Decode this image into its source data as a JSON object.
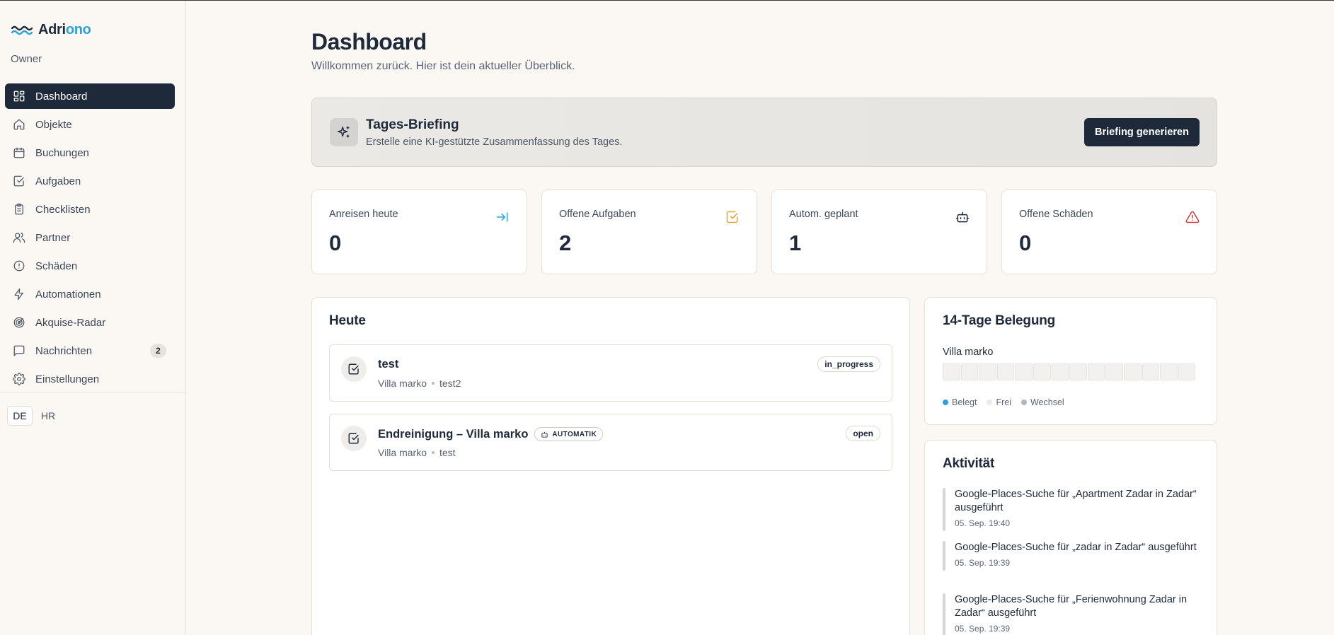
{
  "brand": {
    "part1": "Adri",
    "part2": "ono"
  },
  "role": "Owner",
  "nav": [
    {
      "label": "Dashboard",
      "icon": "dashboard-icon"
    },
    {
      "label": "Objekte",
      "icon": "home-icon"
    },
    {
      "label": "Buchungen",
      "icon": "calendar-icon"
    },
    {
      "label": "Aufgaben",
      "icon": "check-square-icon"
    },
    {
      "label": "Checklisten",
      "icon": "clipboard-icon"
    },
    {
      "label": "Partner",
      "icon": "users-icon"
    },
    {
      "label": "Schäden",
      "icon": "alert-circle-icon"
    },
    {
      "label": "Automationen",
      "icon": "zap-icon"
    },
    {
      "label": "Akquise-Radar",
      "icon": "radar-icon"
    },
    {
      "label": "Nachrichten",
      "icon": "message-icon",
      "badge": "2"
    },
    {
      "label": "Einstellungen",
      "icon": "gear-icon"
    }
  ],
  "languages": {
    "de": "DE",
    "hr": "HR",
    "active": "DE"
  },
  "header": {
    "title": "Dashboard",
    "subtitle": "Willkommen zurück. Hier ist dein aktueller Überblick."
  },
  "briefing": {
    "title": "Tages-Briefing",
    "subtitle": "Erstelle eine KI-gestützte Zusammenfassung des Tages.",
    "button": "Briefing generieren"
  },
  "stats": [
    {
      "label": "Anreisen heute",
      "value": "0",
      "icon": "arrow-in-icon",
      "color": "#2aa3d9"
    },
    {
      "label": "Offene Aufgaben",
      "value": "2",
      "icon": "check-square-icon",
      "color": "#e8a22c"
    },
    {
      "label": "Autom. geplant",
      "value": "1",
      "icon": "robot-icon",
      "color": "#1e2a3a"
    },
    {
      "label": "Offene Schäden",
      "value": "0",
      "icon": "warning-icon",
      "color": "#d23b3b"
    }
  ],
  "today": {
    "title": "Heute",
    "tasks": [
      {
        "title": "test",
        "property": "Villa marko",
        "detail": "test2",
        "status": "in_progress"
      },
      {
        "title": "Endreinigung – Villa marko",
        "badge": "AUTOMATIK",
        "property": "Villa marko",
        "detail": "test",
        "status": "open"
      }
    ]
  },
  "occupancy": {
    "title": "14-Tage Belegung",
    "property": "Villa marko",
    "days": 14,
    "legend": [
      {
        "label": "Belegt",
        "color": "#2aa3d9"
      },
      {
        "label": "Frei",
        "color": "#ebeae7"
      },
      {
        "label": "Wechsel",
        "color": "#a9b7c6"
      }
    ]
  },
  "activity": {
    "title": "Aktivität",
    "items": [
      {
        "text": "Google-Places-Suche für „Apartment Zadar in Zadar“ ausgeführt",
        "time": "05. Sep. 19:40"
      },
      {
        "text": "Google-Places-Suche für „zadar in Zadar“ ausgeführt",
        "time": "05. Sep. 19:39"
      },
      {
        "text": "Google-Places-Suche für „Ferienwohnung Zadar in Zadar“ ausgeführt",
        "time": "05. Sep. 19:39"
      }
    ]
  }
}
